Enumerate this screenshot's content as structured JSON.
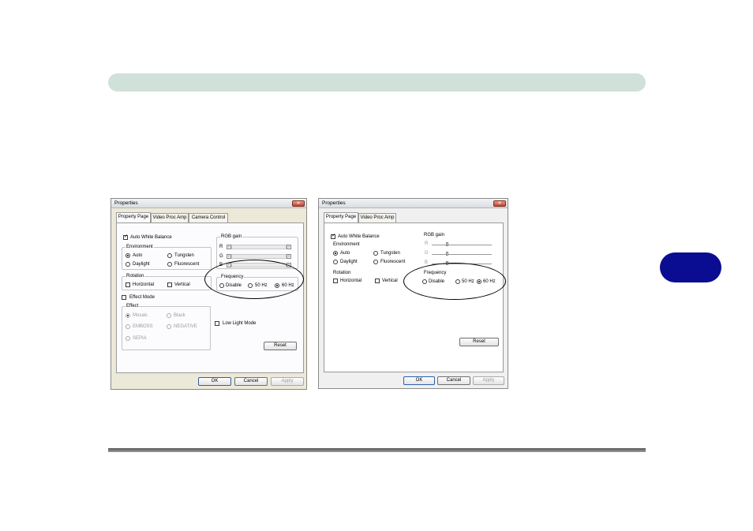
{
  "dialog_a": {
    "title": "Properties",
    "close_glyph": "✕",
    "tabs": [
      "Property Page",
      "Video Proc Amp",
      "Camera Control"
    ],
    "auto_white_balance": "Auto White Balance",
    "environment": {
      "label": "Environment",
      "auto": "Auto",
      "tungsten": "Tungsten",
      "daylight": "Daylight",
      "fluorescent": "Fluorescent"
    },
    "rgb_gain": {
      "label": "RGB gain",
      "r": "R",
      "g": "G",
      "b": "B",
      "left_arrow": "‹",
      "right_arrow": "›"
    },
    "rotation": {
      "label": "Rotation",
      "horizontal": "Horizontal",
      "vertical": "Vertical"
    },
    "frequency": {
      "label": "Frequency",
      "disable": "Disable",
      "hz50": "50 Hz",
      "hz60": "60 Hz"
    },
    "effect_mode": "Effect Mode",
    "effect": {
      "label": "Effect",
      "mosaic": "Mosaic",
      "black": "Black",
      "emboss": "EMBOSS",
      "negative": "NEGATIVE",
      "sepia": "SEPIA"
    },
    "low_light_mode": "Low Light Mode",
    "reset": "Reset",
    "ok": "OK",
    "cancel": "Cancel",
    "apply": "Apply"
  },
  "dialog_b": {
    "title": "Properties",
    "close_glyph": "✕",
    "tabs": [
      "Property Page",
      "Video Proc Amp"
    ],
    "auto_white_balance": "Auto White Balance",
    "environment": {
      "label": "Environment",
      "auto": "Auto",
      "tungsten": "Tungsten",
      "daylight": "Daylight",
      "fluorescent": "Fluorescent"
    },
    "rgb_gain": {
      "label": "RGB gain",
      "r": "R",
      "g": "G",
      "b": "B"
    },
    "rotation": {
      "label": "Rotation",
      "horizontal": "Horizontal",
      "vertical": "Vertical"
    },
    "frequency": {
      "label": "Frequency",
      "disable": "Disable",
      "hz50": "50 Hz",
      "hz60": "60 Hz"
    },
    "reset": "Reset",
    "ok": "OK",
    "cancel": "Cancel",
    "apply": "Apply"
  },
  "colors": {
    "header_bar": "#cfe1d9",
    "chapter_tab": "#0a0d91",
    "highlight_oval": "#000000"
  }
}
